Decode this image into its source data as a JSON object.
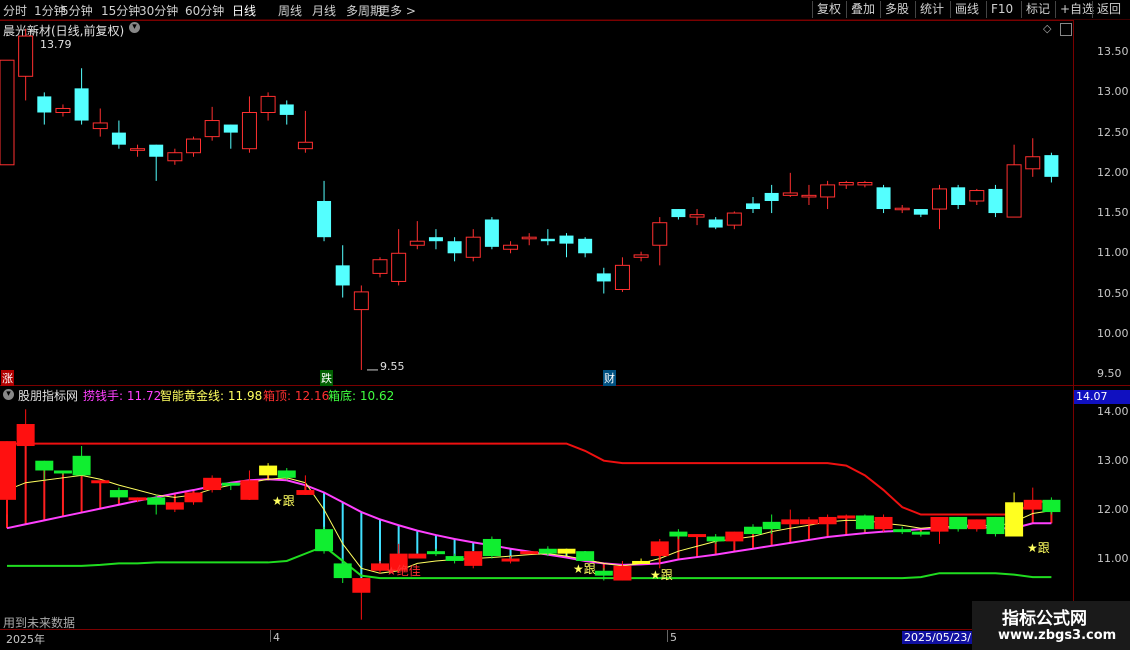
{
  "toolbar": {
    "periods": [
      "分时",
      "1分钟",
      "5分钟",
      "15分钟",
      "30分钟",
      "60分钟",
      "日线",
      "周线",
      "月线",
      "多周期",
      "更多 >"
    ],
    "active_period": "日线",
    "right_buttons": [
      "复权",
      "叠加",
      "多股",
      "统计",
      "画线",
      "F10",
      "标记",
      "+自选",
      "返回"
    ]
  },
  "main_pane": {
    "title": "晨光新材(日线,前复权)",
    "high_label": "13.79",
    "low_label": "9.55",
    "markers": [
      "涨",
      "跌",
      "财"
    ],
    "y_ticks": [
      "13.50",
      "13.00",
      "12.50",
      "12.00",
      "11.50",
      "11.00",
      "10.50",
      "10.00",
      "9.50"
    ]
  },
  "indicator_pane": {
    "name": "股朋指标网",
    "legend": [
      {
        "label": "捞钱手: 11.72",
        "color": "#ff40ff"
      },
      {
        "label": "智能黄金线: 11.98",
        "color": "#ffff60"
      },
      {
        "label": "箱顶: 12.16",
        "color": "#ff3030"
      },
      {
        "label": "箱底: 10.62",
        "color": "#40ff40"
      }
    ],
    "current_value": "14.07",
    "y_ticks": [
      "14.00",
      "13.00",
      "12.00",
      "11.00",
      "10.00"
    ],
    "signals": [
      "★跟",
      "★绝佳",
      "★跟",
      "★跟",
      "★跟"
    ],
    "footer_note": "用到未来数据"
  },
  "date_axis": {
    "labels": [
      "2025年",
      "4",
      "5",
      "2025/05/23/"
    ]
  },
  "watermark": {
    "title": "指标公式网",
    "url": "www.zbgs3.com"
  },
  "colors": {
    "up": "#ff3030",
    "down": "#54ffff",
    "ind_up": "#ff1010",
    "ind_down": "#10ee30",
    "pink": "#ff40ff",
    "yellow": "#ffff60",
    "red_line": "#ee1010",
    "green_line": "#20dd20"
  },
  "chart_data": {
    "type": "candlestick",
    "y_range": [
      9.4,
      13.85
    ],
    "candles": [
      {
        "o": 12.1,
        "c": 13.4,
        "h": 13.4,
        "l": 12.1
      },
      {
        "o": 13.2,
        "c": 13.7,
        "h": 13.79,
        "l": 12.9
      },
      {
        "o": 12.95,
        "c": 12.75,
        "h": 13.0,
        "l": 12.6
      },
      {
        "o": 12.75,
        "c": 12.8,
        "h": 12.85,
        "l": 12.7
      },
      {
        "o": 13.05,
        "c": 12.65,
        "h": 13.3,
        "l": 12.6
      },
      {
        "o": 12.55,
        "c": 12.62,
        "h": 12.8,
        "l": 12.45
      },
      {
        "o": 12.5,
        "c": 12.35,
        "h": 12.65,
        "l": 12.3
      },
      {
        "o": 12.28,
        "c": 12.3,
        "h": 12.35,
        "l": 12.2
      },
      {
        "o": 12.35,
        "c": 12.2,
        "h": 12.35,
        "l": 11.9
      },
      {
        "o": 12.15,
        "c": 12.25,
        "h": 12.3,
        "l": 12.1
      },
      {
        "o": 12.25,
        "c": 12.42,
        "h": 12.45,
        "l": 12.2
      },
      {
        "o": 12.45,
        "c": 12.65,
        "h": 12.82,
        "l": 12.4
      },
      {
        "o": 12.6,
        "c": 12.5,
        "h": 12.6,
        "l": 12.3
      },
      {
        "o": 12.3,
        "c": 12.75,
        "h": 12.95,
        "l": 12.25
      },
      {
        "o": 12.75,
        "c": 12.95,
        "h": 13.0,
        "l": 12.65
      },
      {
        "o": 12.85,
        "c": 12.72,
        "h": 12.9,
        "l": 12.6
      },
      {
        "o": 12.3,
        "c": 12.38,
        "h": 12.77,
        "l": 12.25
      },
      {
        "o": 11.65,
        "c": 11.2,
        "h": 11.9,
        "l": 11.15
      },
      {
        "o": 10.85,
        "c": 10.6,
        "h": 11.1,
        "l": 10.45
      },
      {
        "o": 10.3,
        "c": 10.52,
        "h": 10.6,
        "l": 9.55
      },
      {
        "o": 10.75,
        "c": 10.92,
        "h": 10.95,
        "l": 10.7
      },
      {
        "o": 10.65,
        "c": 11.0,
        "h": 11.3,
        "l": 10.6
      },
      {
        "o": 11.1,
        "c": 11.15,
        "h": 11.4,
        "l": 11.05
      },
      {
        "o": 11.2,
        "c": 11.15,
        "h": 11.3,
        "l": 11.05
      },
      {
        "o": 11.15,
        "c": 11.0,
        "h": 11.2,
        "l": 10.9
      },
      {
        "o": 10.95,
        "c": 11.2,
        "h": 11.3,
        "l": 10.9
      },
      {
        "o": 11.42,
        "c": 11.08,
        "h": 11.45,
        "l": 11.05
      },
      {
        "o": 11.05,
        "c": 11.1,
        "h": 11.15,
        "l": 11.0
      },
      {
        "o": 11.18,
        "c": 11.2,
        "h": 11.25,
        "l": 11.1
      },
      {
        "o": 11.18,
        "c": 11.15,
        "h": 11.3,
        "l": 11.1
      },
      {
        "o": 11.22,
        "c": 11.12,
        "h": 11.25,
        "l": 10.95
      },
      {
        "o": 11.18,
        "c": 11.0,
        "h": 11.2,
        "l": 10.95
      },
      {
        "o": 10.75,
        "c": 10.65,
        "h": 10.82,
        "l": 10.5
      },
      {
        "o": 10.55,
        "c": 10.85,
        "h": 10.95,
        "l": 10.52
      },
      {
        "o": 10.95,
        "c": 10.98,
        "h": 11.02,
        "l": 10.9
      },
      {
        "o": 11.1,
        "c": 11.38,
        "h": 11.45,
        "l": 10.85
      },
      {
        "o": 11.55,
        "c": 11.45,
        "h": 11.55,
        "l": 11.42
      },
      {
        "o": 11.45,
        "c": 11.48,
        "h": 11.55,
        "l": 11.35
      },
      {
        "o": 11.42,
        "c": 11.32,
        "h": 11.45,
        "l": 11.3
      },
      {
        "o": 11.35,
        "c": 11.5,
        "h": 11.52,
        "l": 11.3
      },
      {
        "o": 11.62,
        "c": 11.55,
        "h": 11.7,
        "l": 11.5
      },
      {
        "o": 11.75,
        "c": 11.65,
        "h": 11.85,
        "l": 11.5
      },
      {
        "o": 11.72,
        "c": 11.75,
        "h": 12.0,
        "l": 11.7
      },
      {
        "o": 11.7,
        "c": 11.72,
        "h": 11.85,
        "l": 11.6
      },
      {
        "o": 11.7,
        "c": 11.85,
        "h": 11.9,
        "l": 11.55
      },
      {
        "o": 11.85,
        "c": 11.88,
        "h": 11.9,
        "l": 11.8
      },
      {
        "o": 11.85,
        "c": 11.88,
        "h": 11.9,
        "l": 11.82
      },
      {
        "o": 11.82,
        "c": 11.55,
        "h": 11.85,
        "l": 11.5
      },
      {
        "o": 11.55,
        "c": 11.56,
        "h": 11.6,
        "l": 11.5
      },
      {
        "o": 11.55,
        "c": 11.48,
        "h": 11.55,
        "l": 11.45
      },
      {
        "o": 11.55,
        "c": 11.8,
        "h": 11.85,
        "l": 11.3
      },
      {
        "o": 11.82,
        "c": 11.6,
        "h": 11.85,
        "l": 11.55
      },
      {
        "o": 11.65,
        "c": 11.78,
        "h": 11.8,
        "l": 11.6
      },
      {
        "o": 11.8,
        "c": 11.5,
        "h": 11.85,
        "l": 11.45
      },
      {
        "o": 11.45,
        "c": 12.1,
        "h": 12.35,
        "l": 11.45
      },
      {
        "o": 12.05,
        "c": 12.2,
        "h": 12.43,
        "l": 11.95
      },
      {
        "o": 12.22,
        "c": 11.95,
        "h": 12.25,
        "l": 11.88
      }
    ],
    "ind_y_range": [
      9.6,
      14.2
    ],
    "ind_bars": [
      {
        "o": 12.2,
        "c": 13.4,
        "h": 13.4,
        "l": 11.9
      },
      {
        "o": 13.3,
        "c": 13.75,
        "h": 14.05,
        "l": 13.3
      },
      {
        "o": 13.0,
        "c": 12.8,
        "h": 13.0,
        "l": 12.6
      },
      {
        "o": 12.8,
        "c": 12.75,
        "h": 12.8,
        "l": 12.7
      },
      {
        "o": 13.1,
        "c": 12.7,
        "h": 13.3,
        "l": 12.7
      },
      {
        "o": 12.55,
        "c": 12.6,
        "h": 12.6,
        "l": 12.5
      },
      {
        "o": 12.4,
        "c": 12.25,
        "h": 12.45,
        "l": 12.2
      },
      {
        "o": 12.2,
        "c": 12.25,
        "h": 12.25,
        "l": 12.15
      },
      {
        "o": 12.25,
        "c": 12.1,
        "h": 12.3,
        "l": 11.9
      },
      {
        "o": 12.0,
        "c": 12.15,
        "h": 12.2,
        "l": 11.95
      },
      {
        "o": 12.15,
        "c": 12.35,
        "h": 12.35,
        "l": 12.1
      },
      {
        "o": 12.4,
        "c": 12.65,
        "h": 12.7,
        "l": 12.35
      },
      {
        "o": 12.55,
        "c": 12.5,
        "h": 12.55,
        "l": 12.4
      },
      {
        "o": 12.2,
        "c": 12.6,
        "h": 12.8,
        "l": 12.2
      },
      {
        "o": 12.7,
        "c": 12.9,
        "h": 12.95,
        "l": 12.6,
        "y": 1
      },
      {
        "o": 12.8,
        "c": 12.65,
        "h": 12.85,
        "l": 12.6
      },
      {
        "o": 12.3,
        "c": 12.4,
        "h": 12.7,
        "l": 12.3
      },
      {
        "o": 11.6,
        "c": 11.15,
        "h": 11.65,
        "l": 11.1
      },
      {
        "o": 10.9,
        "c": 10.6,
        "h": 11.0,
        "l": 10.5
      },
      {
        "o": 10.3,
        "c": 10.6,
        "h": 10.6,
        "l": 9.75
      },
      {
        "o": 10.75,
        "c": 10.9,
        "h": 10.95,
        "l": 10.7
      },
      {
        "o": 10.75,
        "c": 11.1,
        "h": 11.3,
        "l": 10.7
      },
      {
        "o": 11.0,
        "c": 11.1,
        "h": 11.1,
        "l": 11.0
      },
      {
        "o": 11.15,
        "c": 11.1,
        "h": 11.2,
        "l": 11.05
      },
      {
        "o": 11.05,
        "c": 10.95,
        "h": 11.1,
        "l": 10.9
      },
      {
        "o": 10.85,
        "c": 11.15,
        "h": 11.15,
        "l": 10.8
      },
      {
        "o": 11.4,
        "c": 11.05,
        "h": 11.45,
        "l": 11.0
      },
      {
        "o": 10.95,
        "c": 11.0,
        "h": 11.05,
        "l": 10.9
      },
      {
        "o": 11.1,
        "c": 11.15,
        "h": 11.15,
        "l": 11.1
      },
      {
        "o": 11.2,
        "c": 11.1,
        "h": 11.25,
        "l": 11.05
      },
      {
        "o": 11.2,
        "c": 11.1,
        "h": 11.2,
        "l": 11.05,
        "y": 1
      },
      {
        "o": 11.15,
        "c": 10.95,
        "h": 11.15,
        "l": 10.95
      },
      {
        "o": 10.75,
        "c": 10.65,
        "h": 10.8,
        "l": 10.55
      },
      {
        "o": 10.55,
        "c": 10.85,
        "h": 10.95,
        "l": 10.55
      },
      {
        "o": 10.9,
        "c": 10.95,
        "h": 11.0,
        "l": 10.9,
        "y": 1
      },
      {
        "o": 11.05,
        "c": 11.35,
        "h": 11.4,
        "l": 10.8
      },
      {
        "o": 11.55,
        "c": 11.45,
        "h": 11.6,
        "l": 11.4
      },
      {
        "o": 11.45,
        "c": 11.5,
        "h": 11.5,
        "l": 11.4
      },
      {
        "o": 11.45,
        "c": 11.35,
        "h": 11.5,
        "l": 11.3
      },
      {
        "o": 11.35,
        "c": 11.55,
        "h": 11.55,
        "l": 11.3
      },
      {
        "o": 11.65,
        "c": 11.5,
        "h": 11.7,
        "l": 11.5
      },
      {
        "o": 11.75,
        "c": 11.6,
        "h": 11.9,
        "l": 11.5
      },
      {
        "o": 11.7,
        "c": 11.8,
        "h": 12.0,
        "l": 11.7
      },
      {
        "o": 11.7,
        "c": 11.8,
        "h": 11.85,
        "l": 11.6
      },
      {
        "o": 11.7,
        "c": 11.85,
        "h": 11.9,
        "l": 11.6
      },
      {
        "o": 11.85,
        "c": 11.88,
        "h": 11.9,
        "l": 11.8
      },
      {
        "o": 11.88,
        "c": 11.6,
        "h": 11.9,
        "l": 11.55
      },
      {
        "o": 11.6,
        "c": 11.85,
        "h": 11.9,
        "l": 11.55
      },
      {
        "o": 11.6,
        "c": 11.55,
        "h": 11.65,
        "l": 11.5
      },
      {
        "o": 11.55,
        "c": 11.5,
        "h": 11.55,
        "l": 11.45
      },
      {
        "o": 11.55,
        "c": 11.85,
        "h": 11.85,
        "l": 11.3
      },
      {
        "o": 11.85,
        "c": 11.6,
        "h": 11.85,
        "l": 11.55
      },
      {
        "o": 11.6,
        "c": 11.8,
        "h": 11.8,
        "l": 11.55
      },
      {
        "o": 11.85,
        "c": 11.5,
        "h": 11.85,
        "l": 11.45
      },
      {
        "o": 11.45,
        "c": 12.15,
        "h": 12.35,
        "l": 11.45,
        "y": 1
      },
      {
        "o": 12.0,
        "c": 12.2,
        "h": 12.45,
        "l": 11.95
      },
      {
        "o": 12.2,
        "c": 11.95,
        "h": 12.25,
        "l": 11.9
      }
    ],
    "series": [
      {
        "name": "捞钱手",
        "values": [
          11.62,
          11.7,
          11.78,
          11.86,
          11.94,
          12.02,
          12.1,
          12.18,
          12.25,
          12.33,
          12.4,
          12.48,
          12.55,
          12.6,
          12.62,
          12.6,
          12.5,
          12.35,
          12.15,
          11.95,
          11.8,
          11.68,
          11.57,
          11.48,
          11.4,
          11.33,
          11.27,
          11.2,
          11.14,
          11.08,
          11.02,
          10.95,
          10.9,
          10.87,
          10.88,
          10.9,
          10.98,
          11.03,
          11.08,
          11.14,
          11.2,
          11.26,
          11.32,
          11.38,
          11.44,
          11.48,
          11.52,
          11.55,
          11.57,
          11.6,
          11.62,
          11.65,
          11.65,
          11.62,
          11.62,
          11.72,
          11.72
        ]
      },
      {
        "name": "智能黄金线",
        "values": [
          12.4,
          12.55,
          12.6,
          12.65,
          12.7,
          12.62,
          12.5,
          12.4,
          12.3,
          12.25,
          12.3,
          12.42,
          12.5,
          12.55,
          12.62,
          12.65,
          12.55,
          12.0,
          11.3,
          10.8,
          10.7,
          10.75,
          10.9,
          10.95,
          10.98,
          11.0,
          11.02,
          11.05,
          11.08,
          11.1,
          11.05,
          10.98,
          10.9,
          10.85,
          10.9,
          11.0,
          11.15,
          11.25,
          11.35,
          11.4,
          11.45,
          11.55,
          11.62,
          11.68,
          11.75,
          11.78,
          11.78,
          11.72,
          11.68,
          11.62,
          11.65,
          11.66,
          11.7,
          11.65,
          11.75,
          11.92,
          11.98
        ]
      },
      {
        "name": "箱顶",
        "values": [
          13.35,
          13.35,
          13.35,
          13.35,
          13.35,
          13.35,
          13.35,
          13.35,
          13.35,
          13.35,
          13.35,
          13.35,
          13.35,
          13.35,
          13.35,
          13.35,
          13.35,
          13.35,
          13.35,
          13.35,
          13.35,
          13.35,
          13.35,
          13.35,
          13.35,
          13.35,
          13.35,
          13.35,
          13.35,
          13.35,
          13.35,
          13.2,
          13.0,
          12.95,
          12.95,
          12.95,
          12.95,
          12.95,
          12.95,
          12.95,
          12.95,
          12.95,
          12.95,
          12.95,
          12.95,
          12.9,
          12.7,
          12.4,
          12.05,
          11.9,
          11.9,
          11.9,
          11.9,
          11.9,
          11.9,
          12.16,
          12.16
        ]
      },
      {
        "name": "箱底",
        "values": [
          10.85,
          10.85,
          10.85,
          10.85,
          10.85,
          10.87,
          10.9,
          10.9,
          10.92,
          10.92,
          10.92,
          10.92,
          10.92,
          10.92,
          10.92,
          10.95,
          11.1,
          11.25,
          10.95,
          10.65,
          10.6,
          10.6,
          10.6,
          10.6,
          10.6,
          10.6,
          10.6,
          10.6,
          10.6,
          10.6,
          10.6,
          10.6,
          10.6,
          10.6,
          10.6,
          10.6,
          10.6,
          10.6,
          10.6,
          10.6,
          10.6,
          10.6,
          10.6,
          10.6,
          10.6,
          10.6,
          10.6,
          10.6,
          10.6,
          10.62,
          10.7,
          10.7,
          10.7,
          10.7,
          10.67,
          10.62,
          10.62
        ]
      }
    ]
  }
}
